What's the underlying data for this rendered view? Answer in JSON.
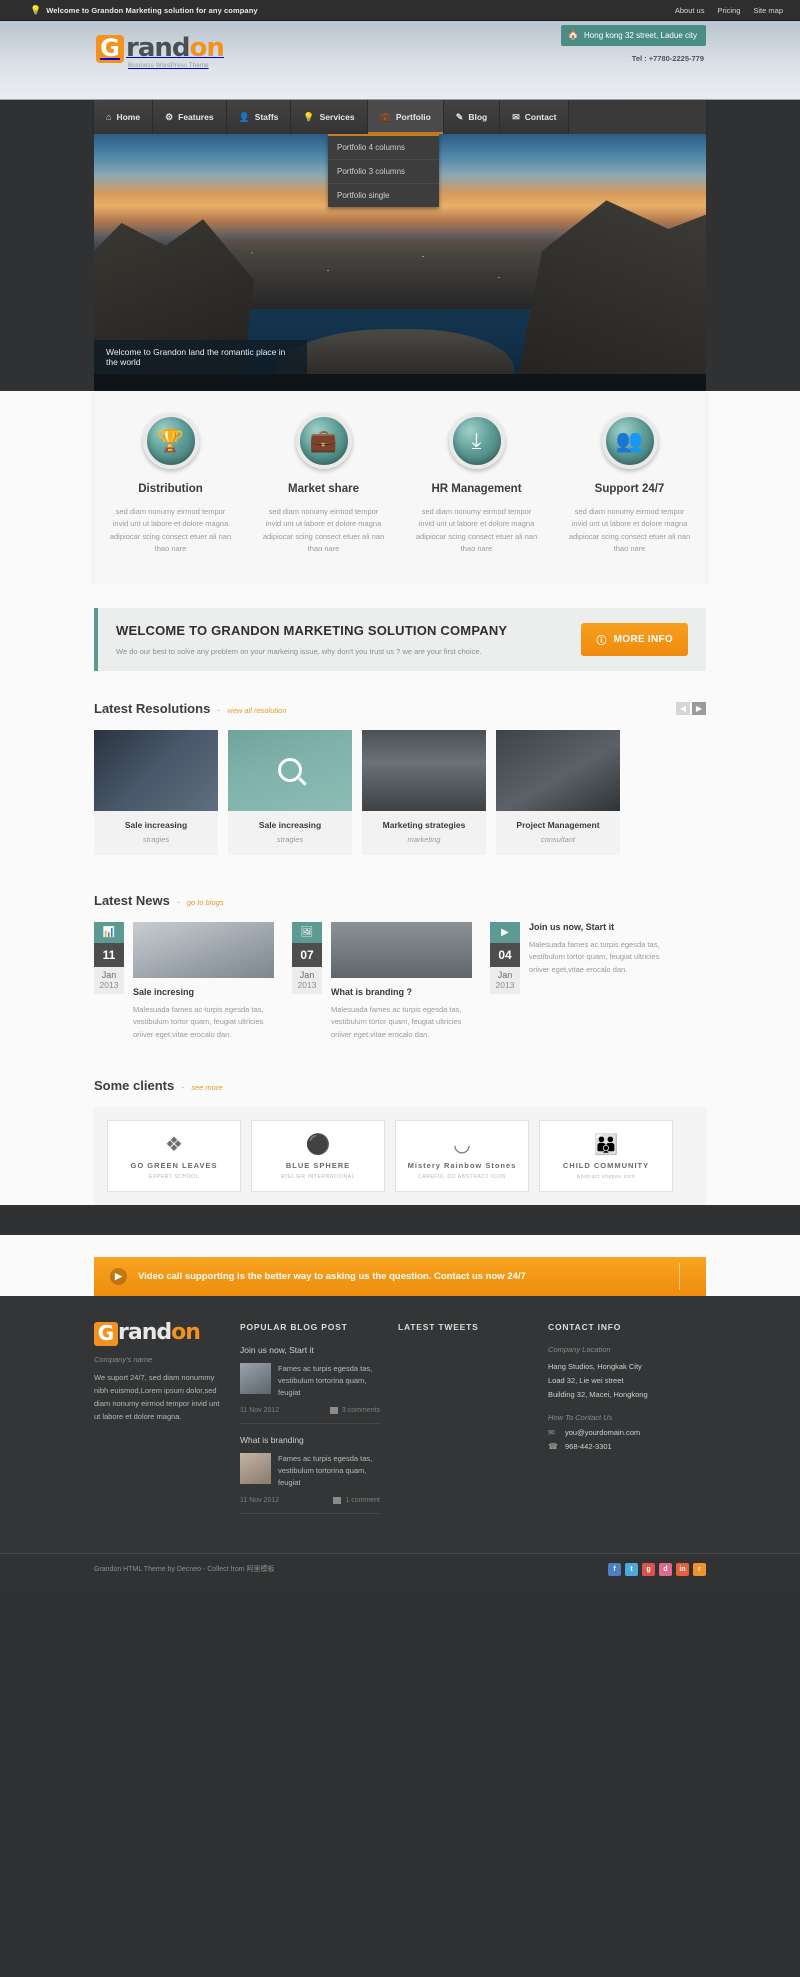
{
  "topbar": {
    "icon": "bulb-icon",
    "welcome": "Welcome to Grandon Marketing solution for any company",
    "links": [
      "About us",
      "Pricing",
      "Site map"
    ]
  },
  "header": {
    "logo_letter": "G",
    "logo_part1": "rand",
    "logo_part2": "on",
    "tagline": "Business WordPress Theme",
    "address_icon": "home-icon",
    "address": "Hong kong 32 street, Ladue city",
    "tel": "Tel : +7780-2225-779"
  },
  "nav": {
    "items": [
      {
        "label": "Home",
        "icon": "home-icon",
        "active": false
      },
      {
        "label": "Features",
        "icon": "gear-icon",
        "active": false
      },
      {
        "label": "Staffs",
        "icon": "user-icon",
        "active": false
      },
      {
        "label": "Services",
        "icon": "bulb-icon",
        "active": false
      },
      {
        "label": "Portfolio",
        "icon": "briefcase-icon",
        "active": true
      },
      {
        "label": "Blog",
        "icon": "pencil-icon",
        "active": false
      },
      {
        "label": "Contact",
        "icon": "mail-icon",
        "active": false
      }
    ],
    "dropdown": [
      "Portfolio 4 columns",
      "Portfolio 3 columns",
      "Portfolio single"
    ]
  },
  "hero": {
    "caption": "Welcome to Grandon land the romantic place in the world"
  },
  "features": [
    {
      "title": "Distribution",
      "icon": "trophy-icon",
      "desc": "sed diam nonumy eirmod tempor invid unt ut labore et dolore magna adipiocar scing consect etuer ali nan thao nare"
    },
    {
      "title": "Market share",
      "icon": "briefcase-icon",
      "desc": "sed diam nonumy eirmod tempor invid unt ut labore et dolore magna adipiocar scing consect etuer ali nan thao nare"
    },
    {
      "title": "HR Management",
      "icon": "download-icon",
      "desc": "sed diam nonumy eirmod tempor invid unt ut labore et dolore magna adipiocar scing consect etuer ali nan thao nare"
    },
    {
      "title": "Support 24/7",
      "icon": "users-icon",
      "desc": "sed diam nonumy eirmod tempor invid unt ut labore et dolore magna adipiocar scing consect etuer ali nan thao nare"
    }
  ],
  "welcome_box": {
    "title": "WELCOME TO GRANDON MARKETING SOLUTION COMPANY",
    "text": "We do our best to solve any problem on your markeing issue, why don't you trust us ? we are your first choice.",
    "button": "MORE INFO",
    "button_icon": "info-icon"
  },
  "resolutions": {
    "heading": "Latest Resolutions",
    "dash": "-",
    "link": "view all resolution",
    "prev_icon": "chevron-left-icon",
    "next_icon": "chevron-right-icon",
    "cards": [
      {
        "title": "Sale increasing",
        "sub": "stragies"
      },
      {
        "title": "Sale increasing",
        "sub": "stragies",
        "overlay": "search-icon"
      },
      {
        "title": "Marketing strategies",
        "sub": "marketing"
      },
      {
        "title": "Project Management",
        "sub": "consultant"
      }
    ]
  },
  "news": {
    "heading": "Latest News",
    "dash": "-",
    "link": "go to blogs",
    "items": [
      {
        "day": "11",
        "month": "Jan",
        "year": "2013",
        "icon": "chart-icon",
        "title": "Sale incresing",
        "desc": "Malesuada fames ac turpis egesda tas, vestibulum tortor quam, feugiat ultricies oriiver eget,vitae erocalo dan.",
        "has_thumb": true,
        "title_below": true
      },
      {
        "day": "07",
        "month": "Jan",
        "year": "2013",
        "icon": "images-icon",
        "title": "What is branding ?",
        "desc": "Malesuada fames ac turpis egesda tas, vestibulum tortor quam, feugiat ultricies oriiver eget,vitae erocalo dan.",
        "has_thumb": true,
        "title_below": true
      },
      {
        "day": "04",
        "month": "Jan",
        "year": "2013",
        "icon": "video-icon",
        "title": "Join us now, Start it",
        "desc": "Malesuada fames ac turpis egesda tas, vestibulum tortor quam, feugiat ultricies oriiver eget,vitae erocalo dan.",
        "has_thumb": false,
        "title_below": false
      }
    ]
  },
  "clients": {
    "heading": "Some clients",
    "dash": "-",
    "link": "see more",
    "items": [
      {
        "mark": "leaf-icon",
        "name": "GO GREEN LEAVES",
        "tag": "EXPERT SCHOOL"
      },
      {
        "mark": "sphere-icon",
        "name": "BLUE SPHERE",
        "tag": "ATELIER INTERNATIONAL"
      },
      {
        "mark": "stones-icon",
        "name": "Mistery Rainbow Stones",
        "tag": "CAREFUL DO ABSTRACT ICON"
      },
      {
        "mark": "community-icon",
        "name": "CHILD COMMUNITY",
        "tag": "Abstract shapes icon"
      }
    ]
  },
  "cta": {
    "icon": "video-call-icon",
    "text": "Video call supporting is the better way to asking us the question. Contact us now 24/7"
  },
  "footer": {
    "logo_letter": "G",
    "logo_part1": "rand",
    "logo_part2": "on",
    "company_label": "Company's name",
    "about": "We suport 24/7, sed diam nonummy nibh euismod,Lorem ipsum dolor,sed diam nonumy eirmod tempor invid unt ut labore et dolore magna.",
    "blog_heading": "POPULAR BLOG POST",
    "posts": [
      {
        "title": "Join us now, Start it",
        "text": "Fames ac turpis egesda tas, vestibulum tortorina quam, feugiat",
        "date": "11 Nov 2012",
        "comments": "3 comments"
      },
      {
        "title": "What is branding",
        "text": "Fames ac turpis egesda tas, vestibulum tortorina quam, feugiat",
        "date": "11 Nov 2012",
        "comments": "1 comment"
      }
    ],
    "tweets_heading": "LATEST TWEETS",
    "contact_heading": "CONTACT INFO",
    "location_label": "Company Location",
    "address_lines": [
      "Hang Studios, Hongkak City",
      "Load 32, Lie wei street",
      "Building 32, Macei, Hongkong"
    ],
    "howto_label": "How To Contact Us",
    "email_icon": "mail-icon",
    "email": "you@yourdomain.com",
    "phone_icon": "phone-icon",
    "phone": "968-442-3301",
    "copyright": "Grandon HTML Theme by Decneo - Collect from 阿里模板",
    "socials": [
      "f",
      "t",
      "g",
      "d",
      "in",
      "r"
    ]
  }
}
